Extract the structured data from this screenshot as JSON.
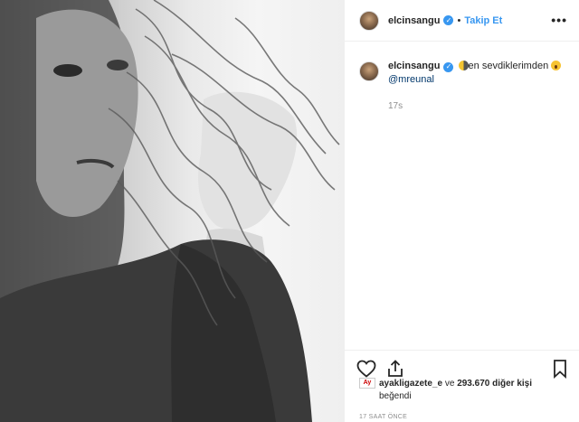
{
  "post": {
    "username": "elcinsangu",
    "separator": "•",
    "follow_label": "Takip Et",
    "more_icon": "•••"
  },
  "caption": {
    "username": "elcinsangu",
    "text": "en sevdiklerimden",
    "mention": "@mreunal",
    "time": "17s"
  },
  "likes": {
    "first_liker": "ayakligazete_e",
    "middle": "ve",
    "count": "293.670 diğer kişi",
    "suffix": "beğendi",
    "liker_badge": "Ay"
  },
  "timestamp": "17 SAAT ÖNCE",
  "icons": {
    "like": "heart-icon",
    "share": "share-icon",
    "save": "bookmark-icon",
    "verified": "verified-badge-icon"
  },
  "colors": {
    "accent": "#3897f0",
    "mention": "#00376b",
    "muted": "#8e8e8e"
  }
}
